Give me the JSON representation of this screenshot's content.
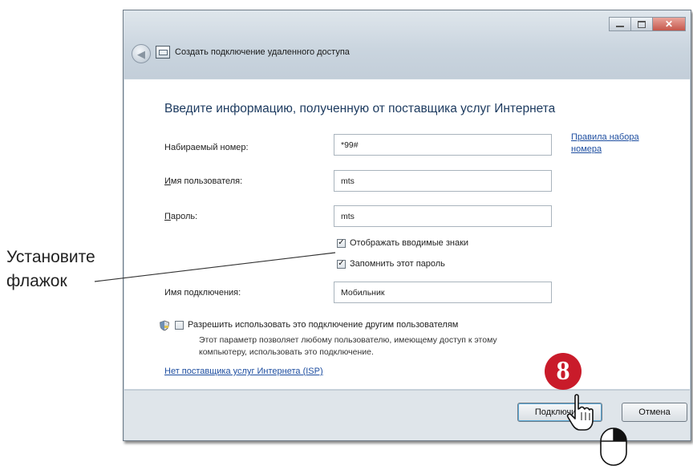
{
  "window": {
    "title": "Создать подключение удаленного доступа",
    "controls": {
      "minimize_icon": "minimize-icon",
      "maximize_icon": "maximize-icon",
      "close_icon": "close-icon",
      "close_glyph": "✕"
    },
    "back_arrow": "◀"
  },
  "main": {
    "heading": "Введите информацию, полученную от поставщика услуг Интернета",
    "dial_number": {
      "label": "Набираемый номер:",
      "value": "*99#"
    },
    "dialing_rules_link": "Правила набора номера",
    "username": {
      "label_accel": "И",
      "label_rest": "мя пользователя:",
      "value": "mts"
    },
    "password": {
      "label_accel": "П",
      "label_rest": "ароль:",
      "value": "mts"
    },
    "show_chars": {
      "label": "Отображать вводимые знаки",
      "checked": true
    },
    "remember_password": {
      "label": "Запомнить этот пароль",
      "checked": true
    },
    "connection_name": {
      "label": "Имя подключения:",
      "value": "Мобильник"
    },
    "allow_others": {
      "label": "Разрешить использовать это подключение другим пользователям",
      "checked": false
    },
    "allow_others_desc": "Этот параметр позволяет любому пользователю, имеющему доступ к этому компьютеру, использовать это подключение.",
    "no_isp_link": "Нет поставщика услуг Интернета (ISP)",
    "check_glyph": "✓"
  },
  "footer": {
    "connect_label": "Подключить",
    "cancel_label": "Отмена"
  },
  "annotation": {
    "line1": "Установите",
    "line2": "флажок",
    "step_number": "8"
  },
  "colors": {
    "step_badge": "#c91b2a",
    "heading": "#1c3a5f",
    "link": "#1e4ea0"
  }
}
